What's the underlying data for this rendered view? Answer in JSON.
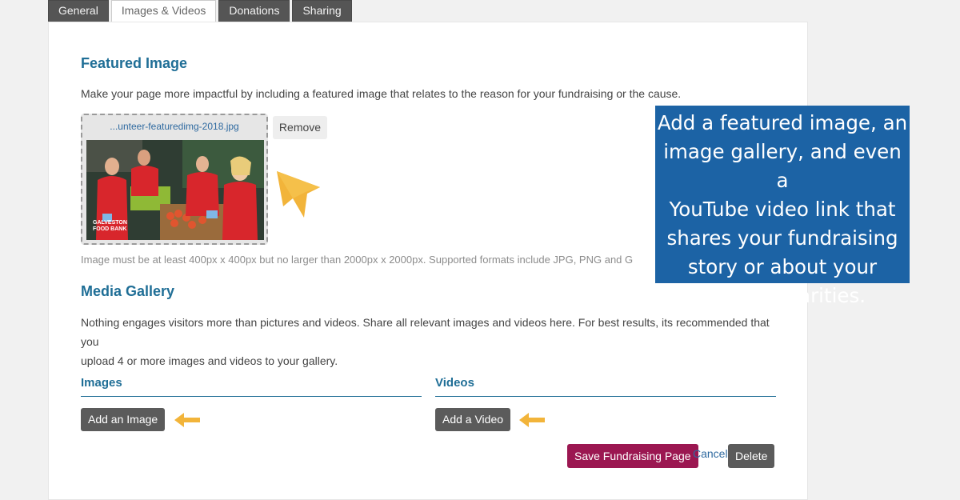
{
  "tabs": [
    {
      "label": "General"
    },
    {
      "label": "Images & Videos"
    },
    {
      "label": "Donations"
    },
    {
      "label": "Sharing"
    }
  ],
  "featured": {
    "title": "Featured Image",
    "description": "Make your page more impactful by including a featured image that relates to the reason for your fundraising or the cause.",
    "filename": "...unteer-featuredimg-2018.jpg",
    "remove_label": "Remove",
    "note": "Image must be at least 400px x 400px but no larger than 2000px x 2000px. Supported formats include JPG, PNG and G",
    "photo_caption": "GALVESTON FOOD BANK"
  },
  "gallery": {
    "title": "Media Gallery",
    "description_line1": "Nothing engages visitors more than pictures and videos. Share all relevant images and videos here. For best results, its recommended that you",
    "description_line2": "upload 4 or more images and videos to your gallery.",
    "images_title": "Images",
    "add_image_label": "Add an Image",
    "videos_title": "Videos",
    "add_video_label": "Add a Video"
  },
  "actions": {
    "save_label": "Save Fundraising Page",
    "cancel_label": "Cancel",
    "delete_label": "Delete"
  },
  "callout": {
    "lines": [
      "Add a featured image, an",
      "image gallery, and even a",
      "YouTube video link that",
      "shares your fundraising",
      "story or about your",
      "chosen charities."
    ]
  },
  "colors": {
    "heading": "#1f6e96",
    "save_button": "#9b1751",
    "dark_button": "#5b5b5b",
    "callout_bg": "#1c63a5",
    "arrow": "#f2b43a"
  }
}
